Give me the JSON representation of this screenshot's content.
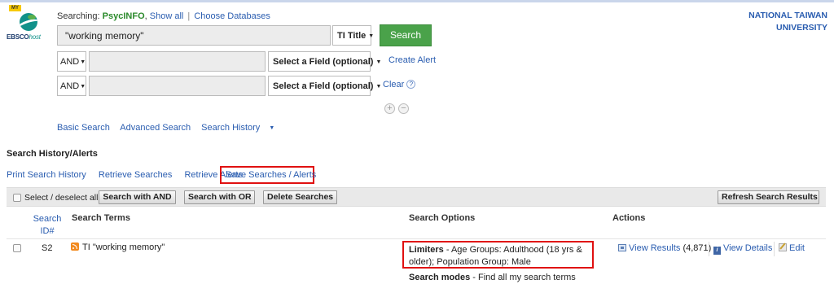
{
  "logo": {
    "badge": "MY",
    "brand_main": "EBSCO",
    "brand_host": "host"
  },
  "header": {
    "searching_label": "Searching:",
    "database": "PsycINFO",
    "show_all": "Show all",
    "separator": "|",
    "choose_databases": "Choose Databases",
    "institution_line1": "NATIONAL TAIWAN",
    "institution_line2": "UNIVERSITY"
  },
  "search": {
    "rows": [
      {
        "query": "\"working memory\"",
        "field": "TI Title"
      },
      {
        "operator": "AND",
        "query": "",
        "field": "Select a Field (optional)"
      },
      {
        "operator": "AND",
        "query": "",
        "field": "Select a Field (optional)"
      }
    ],
    "search_button": "Search",
    "create_alert": "Create Alert",
    "clear": "Clear",
    "help_glyph": "?",
    "add_glyph": "+",
    "remove_glyph": "−"
  },
  "nav": {
    "basic_search": "Basic Search",
    "advanced_search": "Advanced Search",
    "search_history": "Search History"
  },
  "history": {
    "title": "Search History/Alerts",
    "links": {
      "print": "Print Search History",
      "retrieve_searches": "Retrieve Searches",
      "retrieve_alerts": "Retrieve Alerts",
      "save": "Save Searches / Alerts"
    },
    "toolbar": {
      "select_all": "Select / deselect all",
      "search_and": "Search with AND",
      "search_or": "Search with OR",
      "delete": "Delete Searches",
      "refresh": "Refresh Search Results"
    },
    "columns": {
      "id_line1": "Search",
      "id_line2": "ID#",
      "terms": "Search Terms",
      "options": "Search Options",
      "actions": "Actions"
    },
    "rows": [
      {
        "id": "S2",
        "terms": "TI \"working memory\"",
        "limiters_label": "Limiters",
        "limiters_text": " - Age Groups: Adulthood (18 yrs & older); Population Group: Male",
        "modes_label": "Search modes",
        "modes_text": " - Find all my search terms",
        "view_results": "View Results",
        "count": "(4,871)",
        "view_details": "View Details",
        "edit": "Edit"
      }
    ]
  },
  "colors": {
    "link": "#2a5db0",
    "search_button": "#4aa24a",
    "database_name": "#2b8a2b",
    "highlight_box": "#e01010",
    "rss": "#f28a1f"
  }
}
